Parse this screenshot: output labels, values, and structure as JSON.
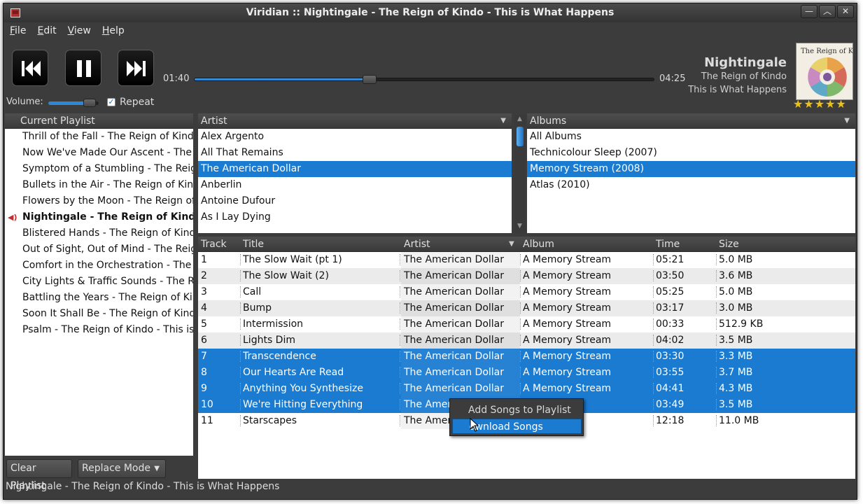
{
  "window": {
    "title": "Viridian :: Nightingale - The Reign of Kindo - This is What Happens"
  },
  "menu": [
    {
      "label": "File",
      "mnemonic": "F",
      "rest": "ile"
    },
    {
      "label": "Edit",
      "mnemonic": "E",
      "rest": "dit"
    },
    {
      "label": "View",
      "mnemonic": "V",
      "rest": "iew"
    },
    {
      "label": "Help",
      "mnemonic": "H",
      "rest": "elp"
    }
  ],
  "player": {
    "elapsed": "01:40",
    "duration": "04:25",
    "progress_percent": 38,
    "volume_label": "Volume:",
    "volume_percent": 82,
    "repeat_label": "Repeat",
    "repeat_checked": true,
    "now_title": "Nightingale",
    "now_artist": "The Reign of Kindo",
    "now_album": "This is What Happens",
    "rating": 5,
    "art_text": "The Reign of Kindo"
  },
  "playlist": {
    "header": "Current Playlist",
    "items": [
      {
        "text": "Thrill of the Fall - The Reign of Kindo -"
      },
      {
        "text": "Now We've Made Our Ascent - The Re"
      },
      {
        "text": "Symptom of a Stumbling - The Reign"
      },
      {
        "text": "Bullets in the Air - The Reign of Kindo"
      },
      {
        "text": "Flowers by the Moon - The Reign of K"
      },
      {
        "text": "Nightingale - The Reign of Kindo"
      },
      {
        "text": "Blistered Hands - The Reign of Kindo"
      },
      {
        "text": "Out of Sight, Out of Mind - The Reign"
      },
      {
        "text": "Comfort in the Orchestration - The Re"
      },
      {
        "text": "City Lights & Traffic Sounds - The Reig"
      },
      {
        "text": "Battling the Years - The Reign of Kind"
      },
      {
        "text": "Soon It Shall Be - The Reign of Kindo -"
      },
      {
        "text": "Psalm - The Reign of Kindo - This is W"
      }
    ]
  },
  "artists": {
    "header": "Artist",
    "items": [
      "Alex Argento",
      "All That Remains",
      "The American Dollar",
      "Anberlin",
      "Antoine Dufour",
      "As I Lay Dying"
    ]
  },
  "albums": {
    "header": "Albums",
    "items": [
      "All Albums",
      "Technicolour Sleep (2007)",
      "Memory Stream (2008)",
      "Atlas (2010)"
    ]
  },
  "tracks": {
    "columns": {
      "track": "Track",
      "title": "Title",
      "artist": "Artist",
      "album": "Album",
      "time": "Time",
      "size": "Size"
    },
    "rows": [
      {
        "track": "1",
        "title": "The Slow Wait (pt 1)",
        "artist": "The American Dollar",
        "album": "A Memory Stream",
        "time": "05:21",
        "size": "5.0 MB"
      },
      {
        "track": "2",
        "title": "The Slow Wait (2)",
        "artist": "The American Dollar",
        "album": "A Memory Stream",
        "time": "03:50",
        "size": "3.6 MB"
      },
      {
        "track": "3",
        "title": "Call",
        "artist": "The American Dollar",
        "album": "A Memory Stream",
        "time": "05:25",
        "size": "5.0 MB"
      },
      {
        "track": "4",
        "title": "Bump",
        "artist": "The American Dollar",
        "album": "A Memory Stream",
        "time": "03:17",
        "size": "3.0 MB"
      },
      {
        "track": "5",
        "title": "Intermission",
        "artist": "The American Dollar",
        "album": "A Memory Stream",
        "time": "00:33",
        "size": "512.9 KB"
      },
      {
        "track": "6",
        "title": "Lights Dim",
        "artist": "The American Dollar",
        "album": "A Memory Stream",
        "time": "04:02",
        "size": "3.5 MB"
      },
      {
        "track": "7",
        "title": "Transcendence",
        "artist": "The American Dollar",
        "album": "A Memory Stream",
        "time": "03:30",
        "size": "3.3 MB"
      },
      {
        "track": "8",
        "title": "Our Hearts Are Read",
        "artist": "The American Dollar",
        "album": "A Memory Stream",
        "time": "03:55",
        "size": "3.7 MB"
      },
      {
        "track": "9",
        "title": "Anything You Synthesize",
        "artist": "The American Dollar",
        "album": "A Memory Stream",
        "time": "04:41",
        "size": "4.3 MB"
      },
      {
        "track": "10",
        "title": "We're Hitting Everything",
        "artist": "The Amer",
        "album": "ream",
        "time": "03:49",
        "size": "3.5 MB"
      },
      {
        "track": "11",
        "title": "Starscapes",
        "artist": "The Amer",
        "album": "ream",
        "time": "12:18",
        "size": "11.0 MB"
      }
    ]
  },
  "context_menu": {
    "items": [
      "Add Songs to Playlist",
      "ownload Songs"
    ]
  },
  "bottom": {
    "clear_label": "Clear Playlist",
    "mode_label": "Replace Mode"
  },
  "status": "Nightingale - The Reign of Kindo - This is What Happens",
  "colors": {
    "selection": "#1a7bd1",
    "background": "#3c3c3c",
    "star": "#e8c020"
  }
}
